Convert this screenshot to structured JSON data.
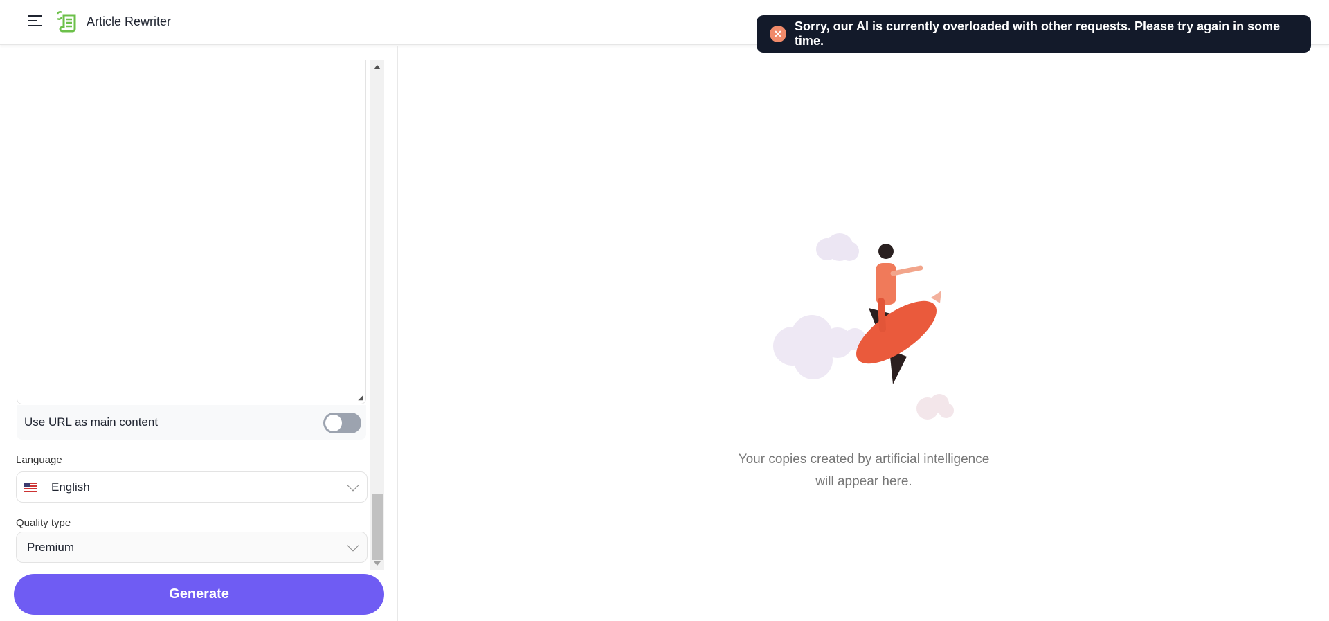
{
  "header": {
    "title": "Article Rewriter",
    "menu_icon": "hamburger-icon",
    "logo_icon": "scroll-rewrite-icon"
  },
  "toast": {
    "message": "Sorry, our AI is currently overloaded with other requests. Please try again in some time.",
    "icon": "error-circle-x-icon",
    "bg_color": "#131a2a"
  },
  "form": {
    "content_value": "",
    "url_toggle": {
      "label": "Use URL as main content",
      "on": false
    },
    "language": {
      "label": "Language",
      "value": "English",
      "flag": "us-flag"
    },
    "quality": {
      "label": "Quality type",
      "value": "Premium"
    },
    "generate_label": "Generate",
    "accent_color": "#6f5cf3"
  },
  "output": {
    "empty_line1": "Your copies created by artificial intelligence",
    "empty_line2": "will appear here."
  }
}
